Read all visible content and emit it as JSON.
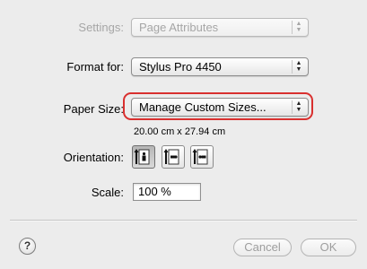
{
  "settings": {
    "label": "Settings:",
    "value": "Page Attributes"
  },
  "format_for": {
    "label": "Format for:",
    "value": "Stylus Pro 4450"
  },
  "paper_size": {
    "label": "Paper Size:",
    "value": "Manage Custom Sizes...",
    "dimensions": "20.00 cm x 27.94 cm"
  },
  "orientation": {
    "label": "Orientation:",
    "options": [
      "portrait",
      "landscape-left",
      "landscape-right"
    ],
    "selected": "portrait"
  },
  "scale": {
    "label": "Scale:",
    "value": "100 %"
  },
  "help": {
    "glyph": "?"
  },
  "buttons": {
    "cancel": "Cancel",
    "ok": "OK"
  },
  "colors": {
    "highlight": "#d9302f",
    "background": "#ececec"
  }
}
